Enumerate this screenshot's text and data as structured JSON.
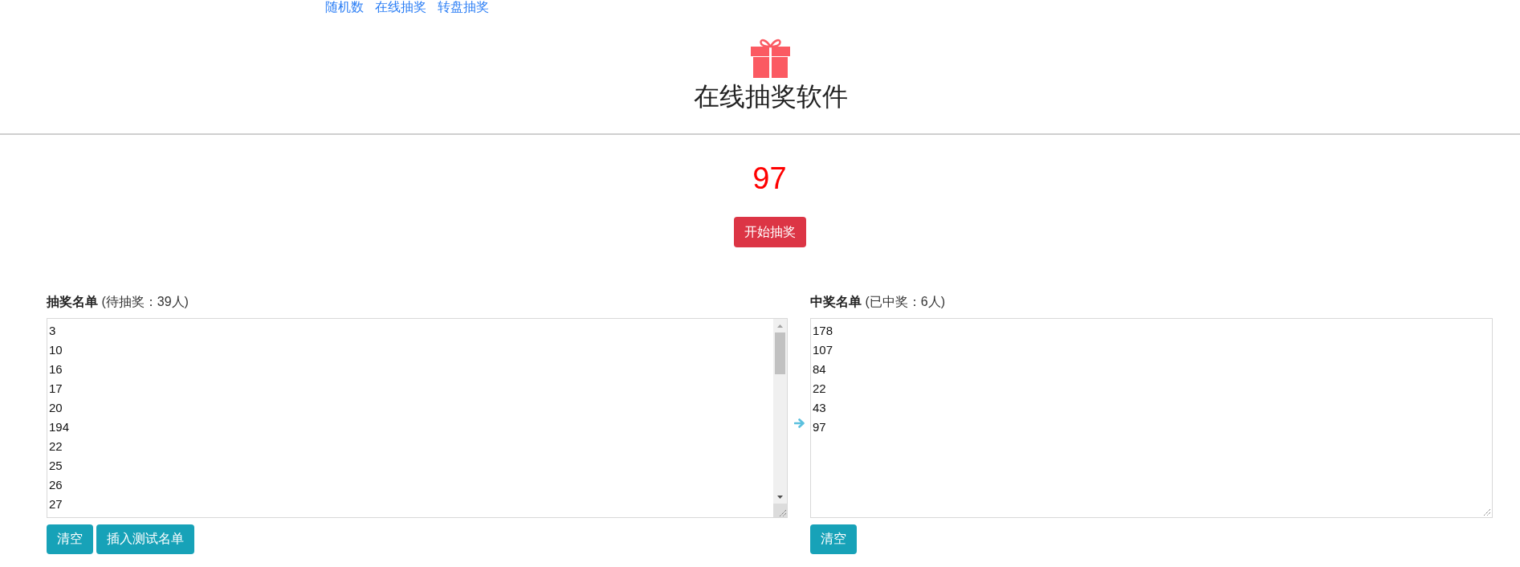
{
  "nav": {
    "links": [
      "随机数",
      "在线抽奖",
      "转盘抽奖"
    ]
  },
  "header": {
    "title": "在线抽奖软件"
  },
  "draw": {
    "result": "97",
    "button": "开始抽奖"
  },
  "lists": [
    {
      "label": "**抽奖名单** (待抽奖：39人)",
      "entries": [
        "3",
        "10",
        "16",
        "17",
        "20",
        "194",
        "22",
        "25",
        "26",
        "27"
      ],
      "scrollbar": true,
      "buttons": [
        "清空",
        "插入测试名单"
      ]
    },
    {
      "label": "**中奖名单** (已中奖：6人)",
      "entries": [
        "178",
        "107",
        "84",
        "22",
        "43",
        "97"
      ],
      "scrollbar": false,
      "buttons": [
        "清空"
      ]
    }
  ]
}
